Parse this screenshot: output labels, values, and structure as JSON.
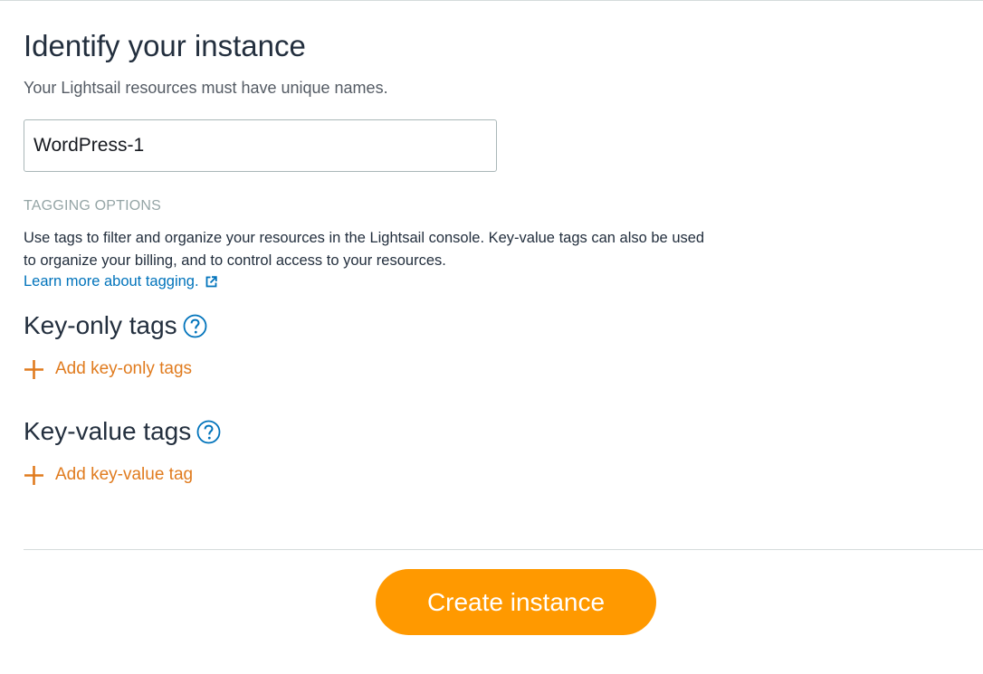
{
  "identify": {
    "title": "Identify your instance",
    "subtitle": "Your Lightsail resources must have unique names.",
    "instance_name_value": "WordPress-1"
  },
  "tagging": {
    "heading": "TAGGING OPTIONS",
    "description": "Use tags to filter and organize your resources in the Lightsail console. Key-value tags can also be used to organize your billing, and to control access to your resources.",
    "learn_more_link": "Learn more about tagging.",
    "learn_more_icon": "external-link-icon"
  },
  "key_only": {
    "heading": "Key-only tags",
    "help_icon": "help-icon",
    "add_label": "Add key-only tags"
  },
  "key_value": {
    "heading": "Key-value tags",
    "help_icon": "help-icon",
    "add_label": "Add key-value tag"
  },
  "footer": {
    "create_label": "Create instance"
  },
  "colors": {
    "accent_orange": "#ff9900",
    "action_orange": "#e07b1e",
    "link_blue": "#0073bb",
    "muted_heading": "#95a5a6"
  }
}
